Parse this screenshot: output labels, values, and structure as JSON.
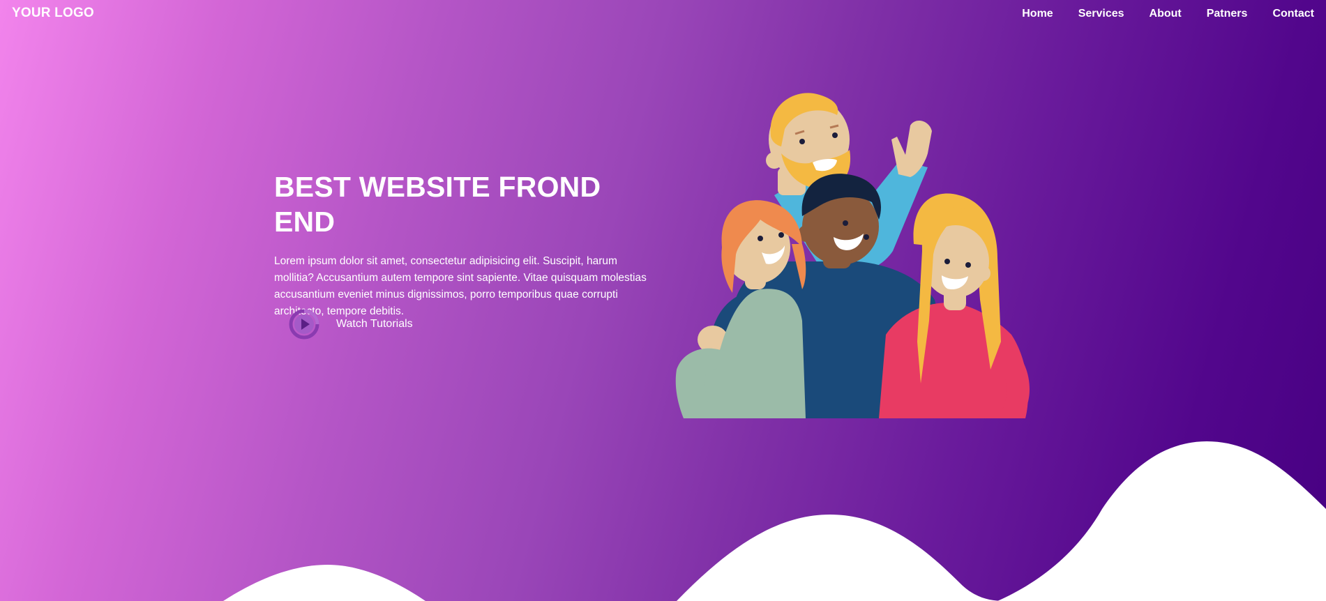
{
  "header": {
    "logo": "YOUR LOGO",
    "nav": [
      "Home",
      "Services",
      "About",
      "Patners",
      "Contact"
    ]
  },
  "hero": {
    "title": "BEST WEBSITE FROND END",
    "body": "Lorem ipsum dolor sit amet, consectetur adipisicing elit. Suscipit, harum mollitia? Accusantium autem tempore sint sapiente. Vitae quisquam molestias accusantium eveniet minus dignissimos, porro temporibus quae corrupti architecto, tempore debitis.",
    "cta": {
      "label": "Watch Tutorials",
      "icon": "play-circle-icon"
    }
  },
  "colors": {
    "gradient_start": "#f284ec",
    "gradient_end": "#470082",
    "wave": "#ffffff",
    "text": "#ffffff"
  }
}
